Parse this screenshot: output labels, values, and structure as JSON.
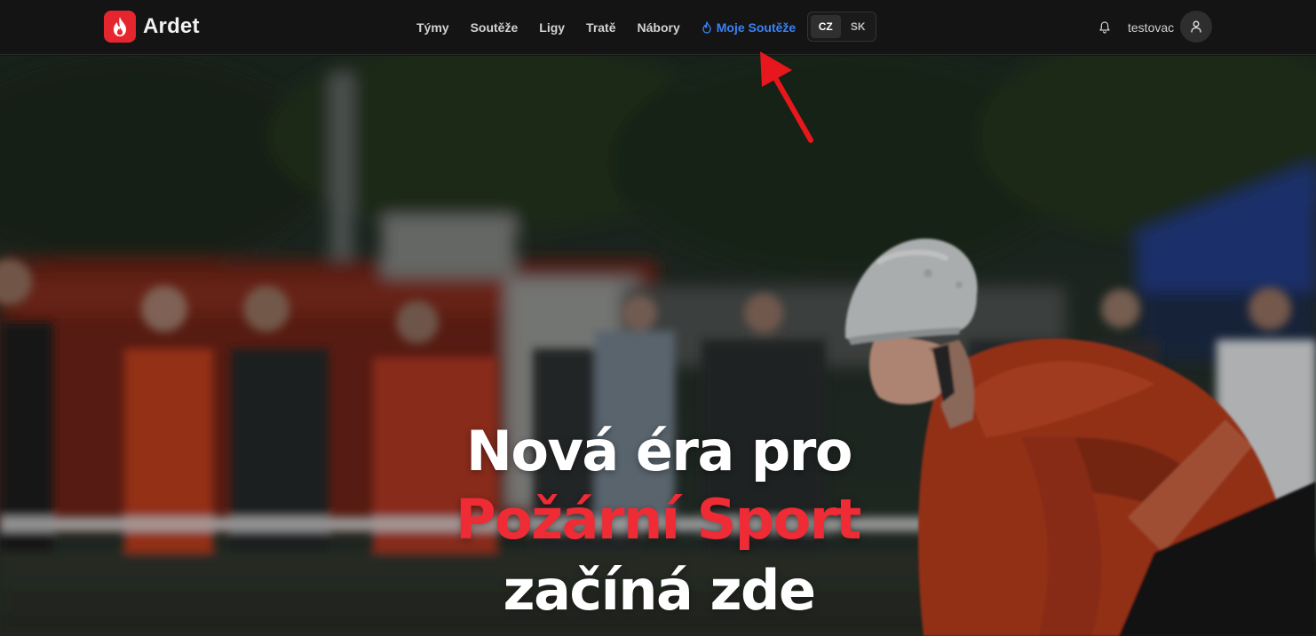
{
  "brand": {
    "name": "Ardet",
    "icon": "flame-icon",
    "color": "#e5262f"
  },
  "nav": {
    "items": [
      {
        "label": "Týmy"
      },
      {
        "label": "Soutěže"
      },
      {
        "label": "Ligy"
      },
      {
        "label": "Tratě"
      },
      {
        "label": "Nábory"
      },
      {
        "label": "Moje Soutěže",
        "icon": "flame-outline-icon",
        "active": true
      }
    ],
    "active_color": "#3b82f6"
  },
  "language": {
    "options": [
      "CZ",
      "SK"
    ],
    "selected": "CZ"
  },
  "user": {
    "name": "testovac",
    "notification_icon": "bell-icon",
    "avatar_icon": "user-icon"
  },
  "hero": {
    "line1": "Nová éra pro",
    "line2": "Požární Sport",
    "line3": "začíná zde",
    "accent_color": "#ef2b35"
  },
  "annotation": {
    "type": "arrow",
    "color": "#e8171d",
    "points_to": "Moje Soutěže"
  }
}
